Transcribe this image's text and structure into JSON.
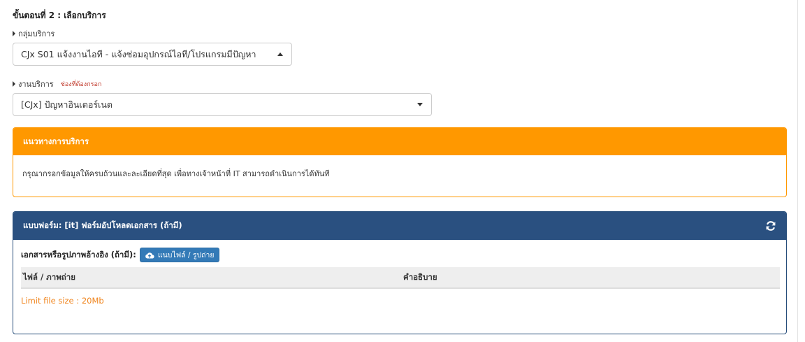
{
  "step": {
    "title": "ขั้นตอนที่ 2 : เลือกบริการ"
  },
  "service_group": {
    "label": "กลุ่มบริการ",
    "selected": "CJx S01 แจ้งงานไอที - แจ้งซ่อมอุปกรณ์ไอที/โปรแกรมมีปัญหา"
  },
  "service_job": {
    "label": "งานบริการ",
    "required_note": "ช่องที่ต้องกรอก",
    "selected": "[CJx] ปัญหาอินเตอร์เนต"
  },
  "guide_panel": {
    "title": "แนวทางการบริการ",
    "body": "กรุณากรอกข้อมูลให้ครบถ้วนและละเอียดที่สุด เพื่อทางเจ้าหน้าที่ IT สามารถดำเนินการได้ทันที",
    "color": "#ff9800"
  },
  "form_panel": {
    "title": "แบบฟอร์ม: [it] ฟอร์มอัปโหลดเอกสาร (ถ้ามี)",
    "refresh_icon": "refresh-icon",
    "color": "#2a5080",
    "attach_label": "เอกสารหรือรูปภาพอ้างอิง (ถ้ามี):",
    "attach_button": "แนบไฟล์ / รูปถ่าย",
    "attach_icon": "cloud-upload-icon",
    "columns": [
      "ไฟล์ / ภาพถ่าย",
      "คำอธิบาย"
    ],
    "limit_text": "Limit file size : 20Mb"
  }
}
